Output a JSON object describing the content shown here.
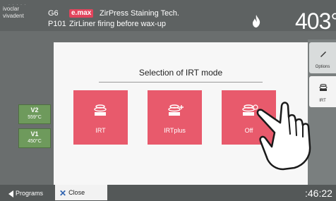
{
  "header": {
    "logo_dots": "· · · · ·",
    "logo_line1": "ivoclar",
    "logo_line2": "vivadent",
    "program_id": "G6",
    "program_num": "P101",
    "emax_badge": "e.max",
    "program_name": "ZirPress Staining Tech.",
    "program_desc": "ZirLiner firing before wax-up",
    "temperature": "403°"
  },
  "side_panel": {
    "options_label": "Options",
    "irt_label": "IRT"
  },
  "stages": [
    {
      "label": "V2",
      "value": "559°C"
    },
    {
      "label": "V1",
      "value": "450°C"
    }
  ],
  "dialog": {
    "title": "Selection of IRT mode",
    "modes": [
      {
        "label": "IRT"
      },
      {
        "label": "IRTplus"
      },
      {
        "label": "Off"
      }
    ]
  },
  "bottom": {
    "programs_label": "Programs",
    "close_label": "Close",
    "clock": ":46:22"
  },
  "colors": {
    "accent_red": "#e85a6c",
    "stage_green": "#6e9a5c",
    "header_bg": "#5e6262"
  },
  "icons": [
    "flame-icon",
    "options-icon",
    "irt-icon",
    "irt-mode-icon",
    "irt-plus-icon",
    "irt-off-icon",
    "close-icon",
    "back-arrow-icon",
    "pointing-hand-icon"
  ]
}
